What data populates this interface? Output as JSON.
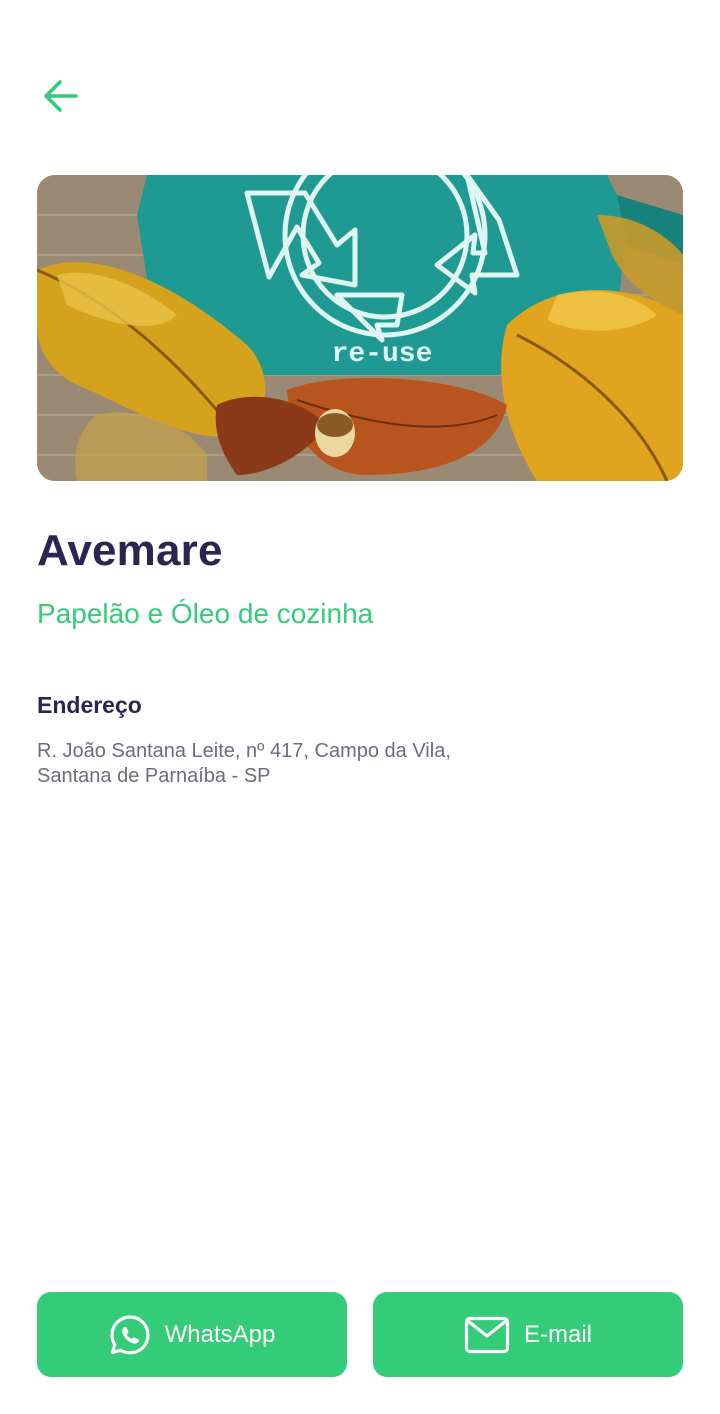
{
  "header": {
    "back_icon": "arrow-left-icon",
    "accent_color": "#34cb79"
  },
  "hero": {
    "image_text": "re-use"
  },
  "point": {
    "name": "Avemare",
    "items": "Papelão e Óleo de cozinha"
  },
  "address": {
    "label": "Endereço",
    "line1": "R. João Santana Leite, nº 417, Campo da Vila,",
    "line2": "Santana de Parnaíba - SP"
  },
  "actions": {
    "whatsapp_label": "WhatsApp",
    "whatsapp_icon": "whatsapp-icon",
    "email_label": "E-mail",
    "email_icon": "mail-icon",
    "button_color": "#34cb79"
  },
  "colors": {
    "title": "#2e2452",
    "text": "#6c6c80"
  }
}
